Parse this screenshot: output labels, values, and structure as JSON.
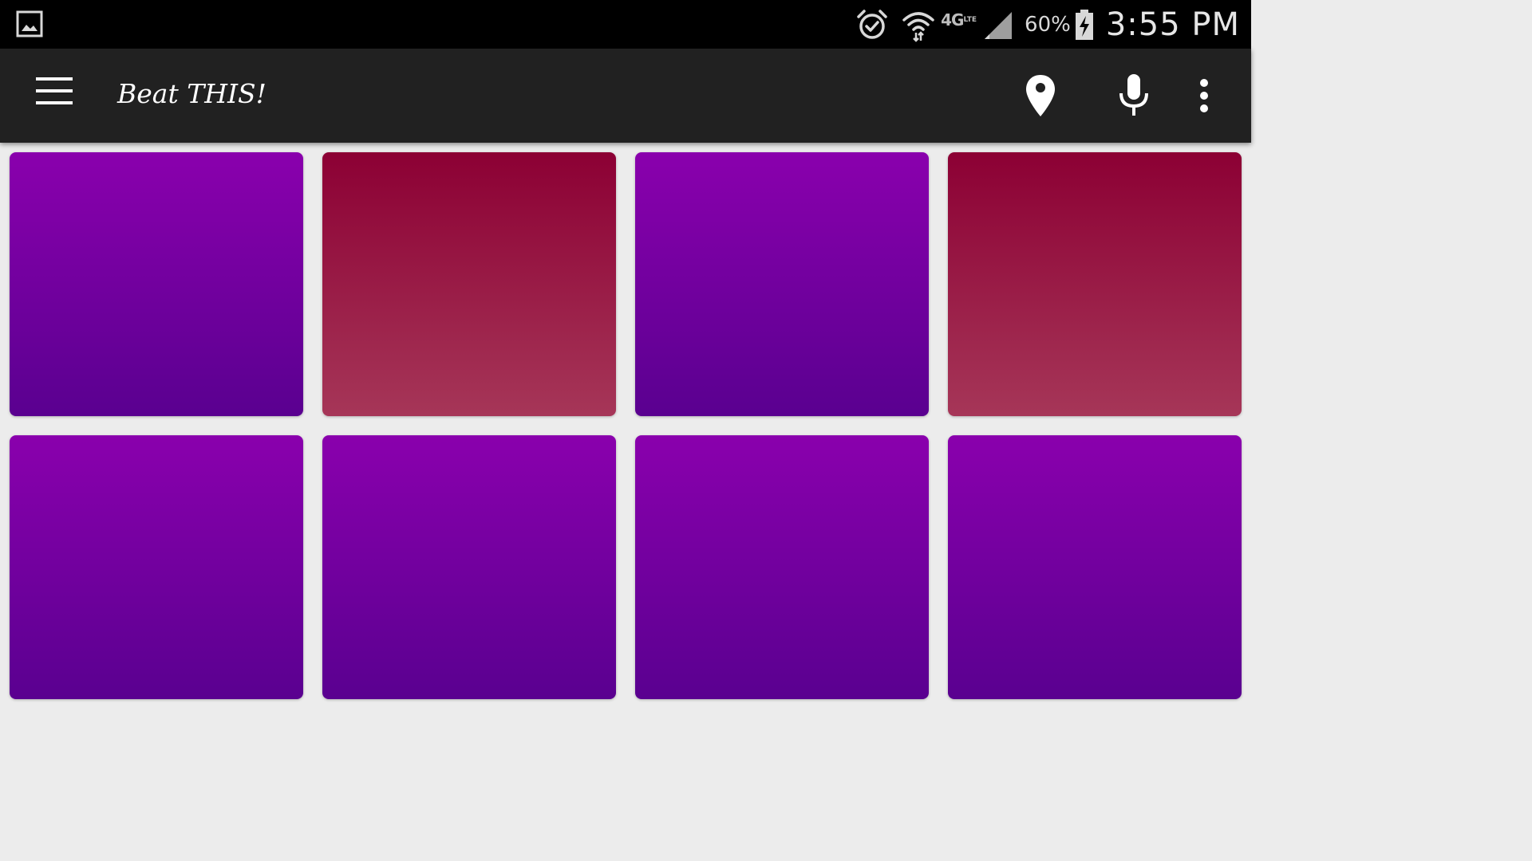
{
  "status_bar": {
    "network": "4G",
    "network_sub": "LTE",
    "battery_percent": "60%",
    "time": "3:55 PM",
    "icons": [
      "gallery-icon",
      "alarm-icon",
      "wifi-icon",
      "signal-icon",
      "battery-charging-icon"
    ]
  },
  "app_bar": {
    "title": "Beat THIS!",
    "actions": [
      "menu-icon",
      "location-pin-icon",
      "microphone-icon",
      "more-vert-icon"
    ]
  },
  "pads": {
    "colors": {
      "purple": "#8a00ad",
      "crimson": "#8c0034"
    },
    "rows": [
      [
        "purple",
        "crimson",
        "purple",
        "crimson"
      ],
      [
        "purple",
        "purple",
        "purple",
        "purple"
      ]
    ]
  }
}
